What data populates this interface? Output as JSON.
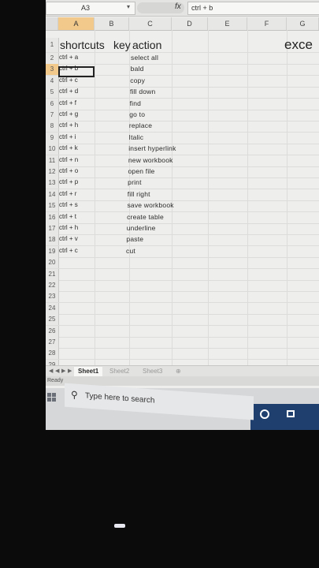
{
  "formula_bar": {
    "name_box": "A3",
    "fx": "fx",
    "value": "ctrl + b"
  },
  "columns": [
    "A",
    "B",
    "C",
    "D",
    "E",
    "F",
    "G"
  ],
  "header_row": {
    "row": "1",
    "a": "shortcuts",
    "b": "key",
    "c": "action",
    "g": "exce"
  },
  "rows": [
    {
      "n": "2",
      "a": "ctrl + a",
      "c": "select all"
    },
    {
      "n": "3",
      "a": "ctrl + b",
      "c": "bald"
    },
    {
      "n": "4",
      "a": "ctrl + c",
      "c": "copy"
    },
    {
      "n": "5",
      "a": "ctrl + d",
      "c": "fill down"
    },
    {
      "n": "6",
      "a": "ctrl + f",
      "c": "find"
    },
    {
      "n": "7",
      "a": "ctrl + g",
      "c": "go to"
    },
    {
      "n": "8",
      "a": "ctrl + h",
      "c": "replace"
    },
    {
      "n": "9",
      "a": "ctrl + i",
      "c": "Italic"
    },
    {
      "n": "10",
      "a": "ctrl + k",
      "c": "insert hyperlink"
    },
    {
      "n": "11",
      "a": "ctrl + n",
      "c": "new workbook"
    },
    {
      "n": "12",
      "a": "ctrl + o",
      "c": "open file"
    },
    {
      "n": "13",
      "a": "ctrl + p",
      "c": "print"
    },
    {
      "n": "14",
      "a": "ctrl + r",
      "c": "fill right"
    },
    {
      "n": "15",
      "a": "ctrl + s",
      "c": "save workbook"
    },
    {
      "n": "16",
      "a": "ctrl + t",
      "c": "create table"
    },
    {
      "n": "17",
      "a": "ctrl + h",
      "c": "underline"
    },
    {
      "n": "18",
      "a": "ctrl + v",
      "c": "paste"
    },
    {
      "n": "19",
      "a": "ctrl + c",
      "c": "cut"
    },
    {
      "n": "20",
      "a": "",
      "c": ""
    },
    {
      "n": "21",
      "a": "",
      "c": ""
    },
    {
      "n": "22",
      "a": "",
      "c": ""
    },
    {
      "n": "23",
      "a": "",
      "c": ""
    },
    {
      "n": "24",
      "a": "",
      "c": ""
    },
    {
      "n": "25",
      "a": "",
      "c": ""
    },
    {
      "n": "26",
      "a": "",
      "c": ""
    },
    {
      "n": "27",
      "a": "",
      "c": ""
    },
    {
      "n": "28",
      "a": "",
      "c": ""
    },
    {
      "n": "29",
      "a": "",
      "c": ""
    }
  ],
  "sheet_tabs": [
    "Sheet1",
    "Sheet2",
    "Sheet3"
  ],
  "active_sheet": "Sheet1",
  "status": "Ready",
  "taskbar": {
    "search_placeholder": "Type here to search"
  },
  "colors": {
    "header_highlight": "#f3c98b",
    "taskbar_accent": "#1f3f6e"
  }
}
